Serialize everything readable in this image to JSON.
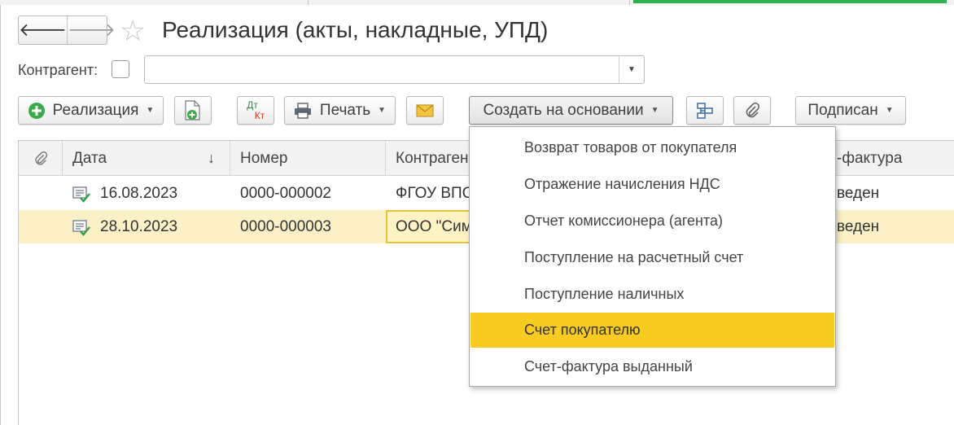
{
  "window": {
    "title": "Реализация (акты, накладные, УПД)"
  },
  "filter": {
    "counterparty_label": "Контрагент:",
    "counterparty_value": ""
  },
  "toolbar": {
    "sale_label": "Реализация",
    "print_label": "Печать",
    "dtkt_top": "Дт",
    "dtkt_bottom": "Кт",
    "create_based_label": "Создать на основании",
    "signed_label": "Подписан"
  },
  "table": {
    "columns": [
      "Дата",
      "Номер",
      "Контраген",
      "-фактура"
    ],
    "sort_indicator": "↓",
    "rows": [
      {
        "date": "16.08.2023",
        "number": "0000-000002",
        "counterparty": "ФГОУ ВПО",
        "invoice": "веден"
      },
      {
        "date": "28.10.2023",
        "number": "0000-000003",
        "counterparty": "ООО \"Сим",
        "invoice": "веден"
      }
    ]
  },
  "dropdown": {
    "items": [
      "Возврат товаров от покупателя",
      "Отражение начисления НДС",
      "Отчет комиссионера (агента)",
      "Поступление на расчетный счет",
      "Поступление наличных",
      "Счет покупателю",
      "Счет-фактура выданный"
    ],
    "highlighted_index": 5,
    "highlight_color": "#f7cb21"
  },
  "colors": {
    "selected_row": "#fbf0c6",
    "accent_green": "#2db14e",
    "current_cell_border": "#e6c33a"
  }
}
